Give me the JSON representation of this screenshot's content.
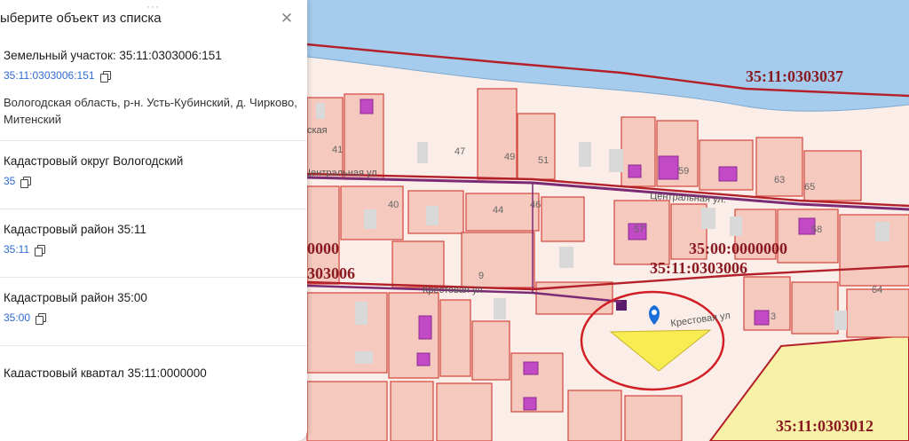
{
  "panel": {
    "title": "ыберите объект из списка",
    "items": [
      {
        "title": "Земельный участок: 35:11:0303006:151",
        "code": "35:11:0303006:151",
        "address": "Вологодская область, р-н. Усть-Кубинский, д. Чирково, Митенский"
      },
      {
        "title": "Кадастровый округ Вологодский",
        "code": "35"
      },
      {
        "title": "Кадастровый район 35:11",
        "code": "35:11"
      },
      {
        "title": "Кадастровый район 35:00",
        "code": "35:00"
      },
      {
        "title": "Кадастровый квартал 35:11:0000000"
      }
    ]
  },
  "map": {
    "labels": {
      "quarter_top": "35:11:0303037",
      "quarter_main": "35:11:0303006",
      "district": "35:00:0000000",
      "quarter_bottom": "35:11:0303012",
      "partial_left_a": "0000",
      "partial_left_b": "303006"
    },
    "streets": {
      "central_1": "Центральная ул",
      "central_2": "Центральная ул.",
      "cross_1": "Крестовая ул",
      "cross_2": "Крестовая ул"
    },
    "house_numbers": {
      "h41": "41",
      "h47": "47",
      "h49": "49",
      "h51": "51",
      "h59": "59",
      "h63": "63",
      "h65": "65",
      "h40": "40",
      "h44": "44",
      "h46": "46",
      "h9": "9",
      "h3": "3",
      "h64": "64",
      "h58": "58",
      "h57": "57"
    },
    "partial_street": "ская",
    "colors": {
      "water": "#a5ccec",
      "parcel_fill": "#f6c9be",
      "parcel_stroke": "#d2453b",
      "quarter_border": "#b4202a",
      "building": "#c24bc5",
      "selection": "#d21f26",
      "highlight": "#f7ec52",
      "pin": "#1c6fd8"
    }
  }
}
